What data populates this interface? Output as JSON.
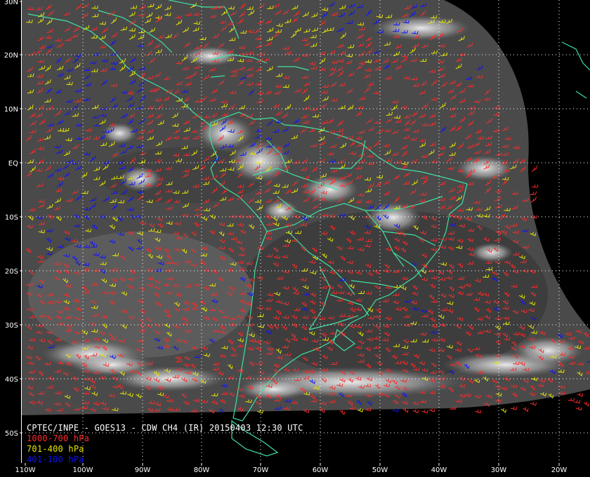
{
  "title": "CPTEC/INPE - GOES13 - CDW CH4 (IR) 20150403 12:30 UTC",
  "legend": [
    {
      "label": "1000-700 hPa",
      "color": "#ff2a2a"
    },
    {
      "label": "701-400 hPa",
      "color": "#e8e800"
    },
    {
      "label": "401-100 hPa",
      "color": "#1010ff"
    }
  ],
  "latitude_labels": [
    "30N",
    "20N",
    "10N",
    "EQ",
    "10S",
    "20S",
    "30S",
    "40S",
    "50S"
  ],
  "longitude_labels": [
    "110W",
    "100W",
    "90W",
    "80W",
    "70W",
    "60W",
    "50W",
    "40W",
    "30W",
    "20W"
  ],
  "colors": {
    "background": "#000000",
    "coastline": "#40e0a0",
    "grid": "#ffffff",
    "label": "#ffffff"
  }
}
